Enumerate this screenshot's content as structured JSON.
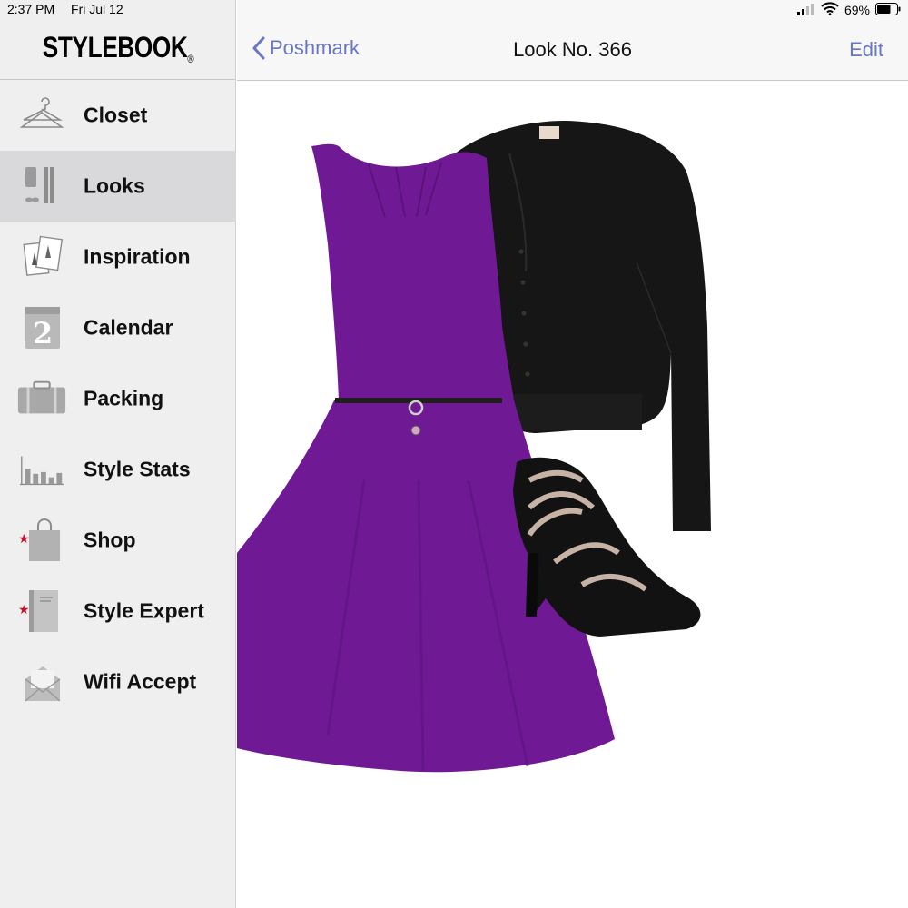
{
  "status": {
    "time": "2:37 PM",
    "date": "Fri Jul 12",
    "battery": "69%",
    "battery_level": 0.69
  },
  "app": {
    "logo": "STYLEBOOK",
    "logo_mark": "®"
  },
  "sidebar": {
    "items": [
      {
        "label": "Closet",
        "icon": "hanger-icon",
        "active": false
      },
      {
        "label": "Looks",
        "icon": "outfit-icon",
        "active": true
      },
      {
        "label": "Inspiration",
        "icon": "photos-icon",
        "active": false
      },
      {
        "label": "Calendar",
        "icon": "calendar-icon",
        "active": false
      },
      {
        "label": "Packing",
        "icon": "suitcase-icon",
        "active": false
      },
      {
        "label": "Style Stats",
        "icon": "bar-chart-icon",
        "active": false
      },
      {
        "label": "Shop",
        "icon": "shopping-bag-icon",
        "active": false,
        "badge": "star"
      },
      {
        "label": "Style Expert",
        "icon": "book-icon",
        "active": false,
        "badge": "star"
      },
      {
        "label": "Wifi Accept",
        "icon": "envelope-icon",
        "active": false
      }
    ]
  },
  "navbar": {
    "back_label": "Poshmark",
    "title": "Look No. 366",
    "edit_label": "Edit"
  },
  "look": {
    "items": [
      {
        "name": "purple-dress",
        "color": "#6f1a94"
      },
      {
        "name": "black-cardigan",
        "color": "#161616"
      },
      {
        "name": "black-sandals",
        "color": "#121212"
      }
    ]
  },
  "colors": {
    "accent": "#6a76c2",
    "sidebar_bg": "#efeff0",
    "active_bg": "#d9d9db",
    "star": "#c8102e"
  }
}
